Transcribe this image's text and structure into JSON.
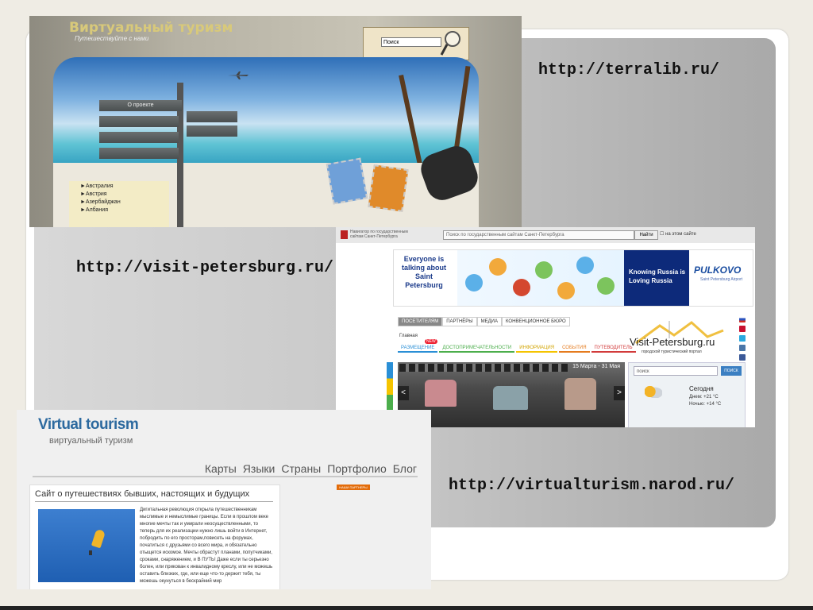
{
  "urls": {
    "terralib": "http://terralib.ru/",
    "visit_petersburg": "http://visit-petersburg.ru/",
    "virtualturism": "http://virtualturism.narod.ru/"
  },
  "terralib": {
    "title": "Виртуальный туризм",
    "subtitle": "Путешествуйте с нами",
    "search_value": "Поиск",
    "sign_label": "О проекте",
    "menu": [
      "►Австралия",
      "►Австрия",
      "►Азербайджан",
      "►Албания"
    ]
  },
  "petersburg": {
    "navigator": "Навигатор по государственным сайтам Санкт-Петербурга",
    "search_placeholder": "Поиск по государственным сайтам Санкт-Петербурга",
    "search_button": "Найти",
    "site_checkbox": "на этом сайте",
    "ad_text": "Everyone is talking about Saint Petersburg",
    "knowing_russia": "Knowing Russia is Loving Russia",
    "pulkovo": "PULKOVO",
    "pulkovo_sub": "Saint Petersburg Airport",
    "tabs": [
      "ПОСЕТИТЕЛЯМ",
      "ПАРТНЁРЫ",
      "МЕДИА",
      "КОНВЕНЦИОННОЕ БЮРО"
    ],
    "breadcrumb": "Главная",
    "new_badge": "NEW",
    "subnav": [
      {
        "label": "РАЗМЕЩЕНИЕ",
        "color": "#2a8fd6"
      },
      {
        "label": "ДОСТОПРИМЕЧАТЕЛЬНОСТИ",
        "color": "#4cae4c"
      },
      {
        "label": "ИНФОРМАЦИЯ",
        "color": "#f5c400"
      },
      {
        "label": "СОБЫТИЯ",
        "color": "#e57b1e"
      },
      {
        "label": "ПУТЕВОДИТЕЛЬ",
        "color": "#d23b3b"
      }
    ],
    "logo": "Visit-Petersburg.ru",
    "logo_sub": "городской туристический портал",
    "photo_date": "15 Марта - 31 Мая",
    "prev": "<",
    "next": ">",
    "weather_search": "поиск",
    "weather_button": "ПОИСК",
    "weather_today": "Сегодня",
    "weather_day": "Днем: +21 °C",
    "weather_night": "Ночью: +14 °C"
  },
  "virtualturism": {
    "title": "Virtual tourism",
    "subtitle": "виртуальный туризм",
    "nav": [
      "Карты",
      "Языки",
      "Страны",
      "Портфолио",
      "Блог"
    ],
    "panel_title": "Сайт о путешествиях бывших, настоящих и будущих",
    "panel_text": "Дигитальная революция открыла путешественникам мыслимые и немыслимые границы. Если в прошлом веке многие мечты так и умирали неосуществленными, то теперь для их реализации нужно лишь войти в Интернет, побродить по его просторам,повисеть на форумах, початиться с друзьями со всего мира, и обязательно отыщется искомое. Мечты обрастут планами, попутчиками, сроками, снаряжением, и В ПУТЬ! Даже если ты серьезно болен, или прикован к инвалидному креслу, или не можешь оставить близких, где, или еще что-то держит тебя, ты можешь окунуться в бескрайний мир",
    "badge": "НАШИ ПАРТНЕРЫ"
  }
}
